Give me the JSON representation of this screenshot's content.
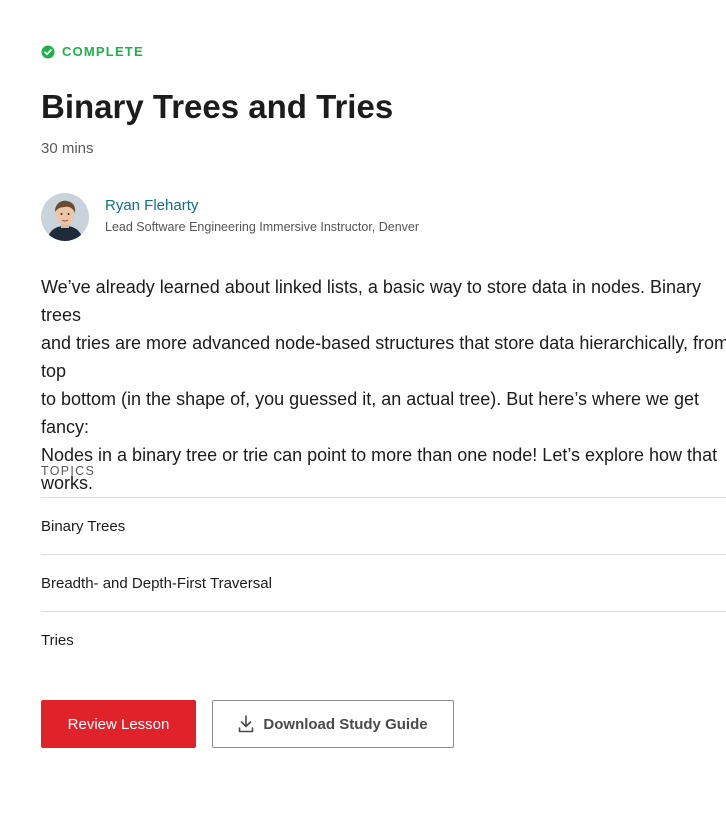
{
  "status": {
    "label": "COMPLETE",
    "icon": "check-circle-icon",
    "color": "#20b04b"
  },
  "lesson": {
    "title": "Binary Trees and Tries",
    "duration": "30 mins",
    "description": "We’ve already learned about linked lists, a basic way to store data in nodes. Binary trees\nand tries are more advanced node-based structures that store data hierarchically, from top\nto bottom (in the shape of, you guessed it, an actual tree). But here’s where we get fancy:\nNodes in a binary tree or trie can point to more than one node! Let’s explore how that\nworks."
  },
  "author": {
    "name": "Ryan Fleharty",
    "role": "Lead Software Engineering Immersive Instructor, Denver",
    "avatar_icon": "avatar"
  },
  "topics": {
    "heading": "TOPICS",
    "items": [
      "Binary Trees",
      "Breadth- and Depth-First Traversal",
      "Tries"
    ]
  },
  "actions": {
    "primary_label": "Review Lesson",
    "secondary_label": "Download Study Guide",
    "secondary_icon": "download-icon",
    "primary_color": "#e0232b"
  }
}
